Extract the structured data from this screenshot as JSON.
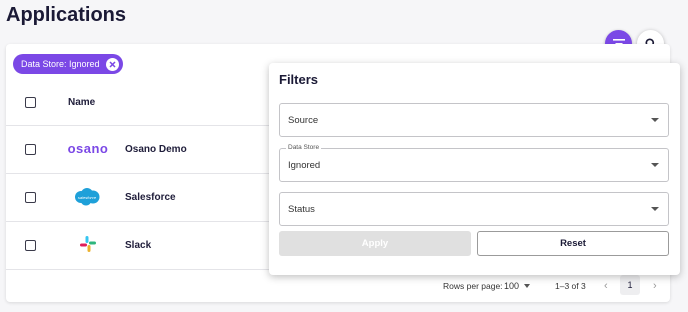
{
  "page": {
    "title": "Applications"
  },
  "toolbar": {
    "filter_icon": "filter-icon",
    "search_icon": "search-icon"
  },
  "active_filter": {
    "label": "Data Store: Ignored",
    "remove_icon": "close-circle-icon"
  },
  "table": {
    "columns": [
      "Name"
    ],
    "rows": [
      {
        "name": "Osano Demo",
        "logo": "osano",
        "logo_text": "osano"
      },
      {
        "name": "Salesforce",
        "logo": "salesforce",
        "logo_text": "salesforce"
      },
      {
        "name": "Slack",
        "logo": "slack"
      }
    ]
  },
  "pagination": {
    "rows_per_page_label": "Rows per page:",
    "rows_per_page": "100",
    "range": "1–3 of 3",
    "current_page": "1"
  },
  "filters": {
    "title": "Filters",
    "fields": [
      {
        "label": "",
        "value": "Source"
      },
      {
        "label": "Data Store",
        "value": "Ignored"
      },
      {
        "label": "",
        "value": "Status"
      }
    ],
    "apply_label": "Apply",
    "reset_label": "Reset"
  },
  "colors": {
    "accent": "#7b48e6",
    "text": "#1b1a36",
    "salesforce": "#1ea0d9"
  }
}
